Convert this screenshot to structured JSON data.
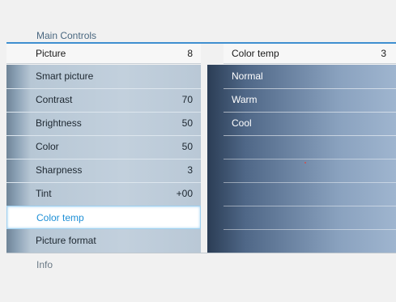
{
  "menu": {
    "title": "Main Controls",
    "header": {
      "label": "Picture",
      "value": "8"
    },
    "items": [
      {
        "label": "Smart picture",
        "value": ""
      },
      {
        "label": "Contrast",
        "value": "70"
      },
      {
        "label": "Brightness",
        "value": "50"
      },
      {
        "label": "Color",
        "value": "50"
      },
      {
        "label": "Sharpness",
        "value": "3"
      },
      {
        "label": "Tint",
        "value": "+00"
      },
      {
        "label": "Color temp",
        "value": "",
        "selected": true
      },
      {
        "label": "Picture format",
        "value": ""
      }
    ]
  },
  "submenu": {
    "header": {
      "label": "Color temp",
      "value": "3"
    },
    "options": [
      "Normal",
      "Warm",
      "Cool"
    ]
  },
  "footer": {
    "info": "Info"
  },
  "colors": {
    "accent": "#3f8fd0",
    "selected_text": "#1d8fd6"
  }
}
